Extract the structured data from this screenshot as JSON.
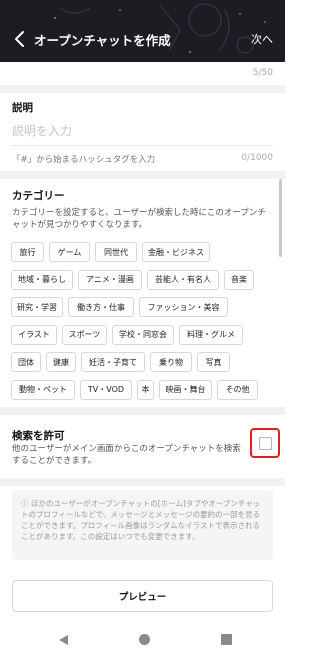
{
  "header": {
    "title": "オープンチャットを作成",
    "next_label": "次へ",
    "back_icon": "chevron-left-icon"
  },
  "name_counter": "5/50",
  "description": {
    "title": "説明",
    "placeholder": "説明を入力",
    "hashtag_hint": "「#」から始まるハッシュタグを入力",
    "counter": "0/1000"
  },
  "category": {
    "title": "カテゴリー",
    "description": "カテゴリーを設定すると、ユーザーが検索した時にこのオープンチャットが見つかりやすくなります。",
    "rows": [
      [
        "旅行",
        "ゲーム",
        "同世代",
        "金融・ビジネス"
      ],
      [
        "地域・暮らし",
        "アニメ・漫画",
        "芸能人・有名人",
        "音楽"
      ],
      [
        "研究・学習",
        "働き方・仕事",
        "ファッション・美容"
      ],
      [
        "イラスト",
        "スポーツ",
        "学校・同窓会",
        "料理・グルメ"
      ],
      [
        "団体",
        "健康",
        "妊活・子育て",
        "乗り物",
        "写真"
      ],
      [
        "動物・ペット",
        "TV・VOD",
        "本",
        "映画・舞台",
        "その他"
      ]
    ]
  },
  "search_permission": {
    "title": "検索を許可",
    "description": "他のユーザーがメイン画面からこのオープンチャットを検索することができます。",
    "checked": false
  },
  "notice": {
    "icon": "info-circle-icon",
    "text": "ほかのユーザーがオープンチャットの[ホーム]タブやオープンチャットのプロフィールなどで、メッセージとメッセージの要約の一部を見ることができます。プロフィール画像はランダムなイラストで表示されることがあります。この設定はいつでも変更できます。"
  },
  "preview_label": "プレビュー",
  "nav": {
    "back_icon": "triangle-back-icon",
    "home_icon": "circle-home-icon",
    "recent_icon": "square-recent-icon"
  },
  "colors": {
    "header_bg": "#1c1c22",
    "highlight": "#e3201b"
  }
}
